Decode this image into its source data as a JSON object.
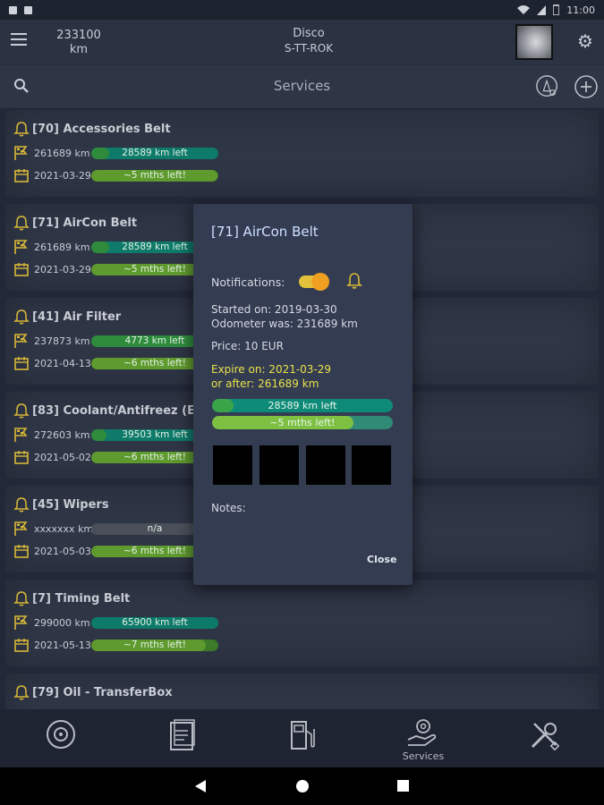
{
  "statusbar": {
    "time": "11:00"
  },
  "appbar": {
    "odometer_value": "233100",
    "odometer_unit": "km",
    "vehicle_name": "Disco",
    "vehicle_plate": "S-TT-ROK"
  },
  "subbar": {
    "title": "Services"
  },
  "services": [
    {
      "name": "[70] Accessories Belt",
      "km": "261689 km",
      "km_left": "28589 km left",
      "km_fill": 0.14,
      "date": "2021-03-29",
      "time_left": "~5 mths left!",
      "time_fill": 0.99
    },
    {
      "name": "[71] AirCon Belt",
      "km": "261689 km",
      "km_left": "28589 km left",
      "km_fill": 0.14,
      "date": "2021-03-29",
      "time_left": "~5 mths left!",
      "time_fill": 0.99
    },
    {
      "name": "[41] Air Filter",
      "km": "237873 km",
      "km_left": "4773 km left",
      "km_fill": 1.0,
      "date": "2021-04-13",
      "time_left": "~6 mths left!",
      "time_fill": 0.99
    },
    {
      "name": "[83] Coolant/Antifreez (Engin",
      "km": "272603 km",
      "km_left": "39503 km left",
      "km_fill": 0.12,
      "date": "2021-05-02",
      "time_left": "~6 mths left!",
      "time_fill": 0.99
    },
    {
      "name": "[45] Wipers",
      "km": "xxxxxxx km",
      "km_left": "n/a",
      "km_fill": 0,
      "na": true,
      "date": "2021-05-03",
      "time_left": "~6 mths left!",
      "time_fill": 0.99
    },
    {
      "name": "[7] Timing Belt",
      "km": "299000 km",
      "km_left": "65900 km left",
      "km_fill": 0.0,
      "date": "2021-05-13",
      "time_left": "~7 mths left!",
      "time_fill": 0.9
    },
    {
      "name": "[79] Oil - TransferBox"
    }
  ],
  "dialog": {
    "title": "[71] AirCon Belt",
    "notifications_label": "Notifications:",
    "notifications_on": true,
    "started_on": "Started on: 2019-03-30",
    "odometer_was": "Odometer was: 231689 km",
    "price": "Price: 10 EUR",
    "expire_on": "Expire on: 2021-03-29",
    "or_after": "or after: 261689 km",
    "km_left": "28589 km left",
    "km_fill": 0.12,
    "time_left": "~5 mths left!",
    "time_fill": 0.78,
    "notes_label": "Notes:",
    "close_label": "Close"
  },
  "bottomnav": {
    "items": [
      {
        "icon": "tire-icon",
        "label": ""
      },
      {
        "icon": "documents-icon",
        "label": ""
      },
      {
        "icon": "fuel-pump-icon",
        "label": ""
      },
      {
        "icon": "services-icon",
        "label": "Services"
      },
      {
        "icon": "tools-icon",
        "label": ""
      }
    ]
  },
  "colors": {
    "accent_teal": "#0e7a6a",
    "accent_green": "#3aa548",
    "warning_yellow": "#e8e24a",
    "bell_yellow": "#d8b838",
    "toggle_orange": "#f0a020"
  }
}
